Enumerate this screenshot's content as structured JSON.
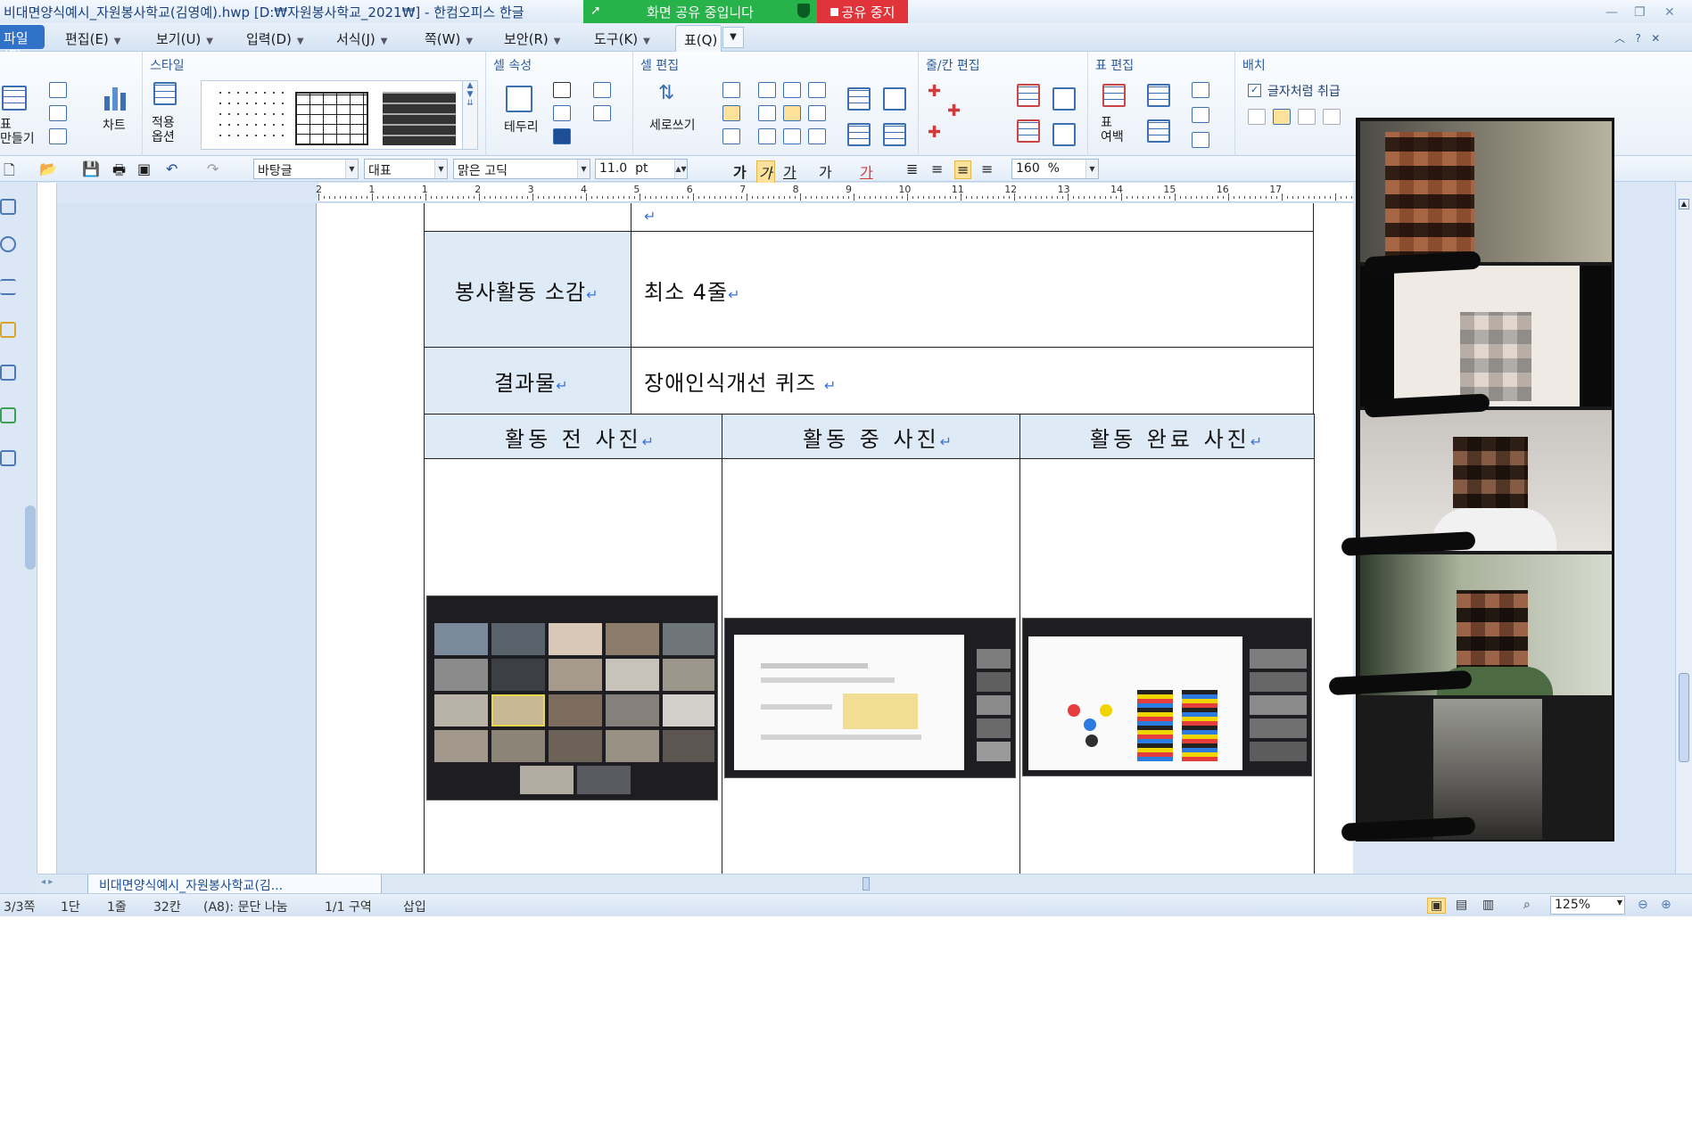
{
  "window": {
    "title": "비대면양식예시_자원봉사학교(김영예).hwp [D:₩자원봉사학교_2021₩] - 한컴오피스 한글"
  },
  "share_banner": {
    "status": "화면 공유 중입니다",
    "stop": "공유 중지",
    "color_status": "#27b24a",
    "color_stop": "#e0343a"
  },
  "menu": {
    "file": "파일(F)",
    "items": [
      "편집(E)",
      "보기(U)",
      "입력(D)",
      "서식(J)",
      "쪽(W)",
      "보안(R)",
      "도구(K)"
    ],
    "active_tab": "표(Q)"
  },
  "ribbon": {
    "make_table": "표\n만들기",
    "chart": "차트",
    "style_group": "스타일",
    "apply_options": "적용\n옵션",
    "cell_props_group": "셀 속성",
    "border": "테두리",
    "cell_edit_group": "셀 편집",
    "vertical_write": "세로쓰기",
    "row_col_group": "줄/칸 편집",
    "table_edit_group": "표 편집",
    "table_margin": "표\n여백",
    "placement_group": "배치",
    "treat_as_char": "글자처럼 취급"
  },
  "format_toolbar": {
    "style": "바탕글",
    "lang": "대표",
    "font": "맑은 고딕",
    "size": "11.0",
    "size_unit": "pt",
    "line_spacing": "160",
    "line_spacing_unit": "%"
  },
  "document": {
    "rows": [
      {
        "label": "봉사활동 소감",
        "value": "최소 4줄"
      },
      {
        "label": "결과물",
        "value": "장애인식개선 퀴즈"
      }
    ],
    "photo_headers": [
      "활동 전 사진",
      "활동 중 사진",
      "활동 완료 사진"
    ]
  },
  "doc_tab": "비대면양식예시_자원봉사학교(김...",
  "status_bar": {
    "page": "3/3쪽",
    "section": "1단",
    "line": "1줄",
    "col": "32칸",
    "para": "(A8): 문단 나눔",
    "area": "1/1 구역",
    "mode": "삽입",
    "zoom": "125%"
  },
  "ruler_numbers": [
    "2",
    "1",
    "1",
    "2",
    "3",
    "4",
    "5",
    "6",
    "7",
    "8",
    "9",
    "10",
    "11",
    "12",
    "13",
    "14",
    "15",
    "16",
    "17"
  ],
  "video_participants": 5
}
